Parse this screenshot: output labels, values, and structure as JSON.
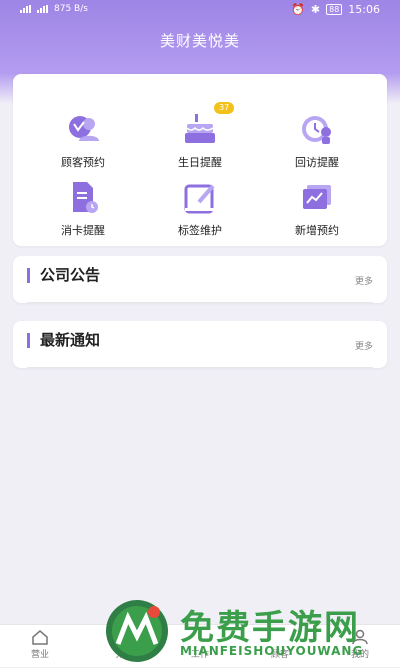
{
  "status_bar": {
    "left_info": "875 B/s",
    "battery": "88",
    "time": "15:06"
  },
  "app_title": "美财美悦美",
  "quick_actions": [
    {
      "label": "顾客预约",
      "icon": "customer-booking-icon"
    },
    {
      "label": "生日提醒",
      "icon": "birthday-cake-icon",
      "badge": "37"
    },
    {
      "label": "回访提醒",
      "icon": "revisit-reminder-icon"
    },
    {
      "label": "消卡提醒",
      "icon": "card-consume-reminder-icon"
    },
    {
      "label": "标签维护",
      "icon": "tag-edit-icon"
    },
    {
      "label": "新增预约",
      "icon": "new-booking-icon"
    }
  ],
  "sections": {
    "announcement": {
      "title": "公司公告",
      "more": "更多"
    },
    "notice": {
      "title": "最新通知",
      "more": "更多"
    }
  },
  "bottom_nav": [
    {
      "label": "营业",
      "icon": "home-icon"
    },
    {
      "label": "分",
      "icon": "analysis-icon"
    },
    {
      "label": "工作",
      "icon": "work-icon"
    },
    {
      "label": "顾客",
      "icon": "customer-icon"
    },
    {
      "label": "我的",
      "icon": "profile-icon"
    }
  ],
  "watermark": {
    "title": "免费手游网",
    "subtitle": "MIANFEISHOUYOUWANG"
  },
  "colors": {
    "accent": "#8e6fe0",
    "header": "#a68cec",
    "badge": "#f2c21b",
    "watermark": "#3a9e4b"
  }
}
